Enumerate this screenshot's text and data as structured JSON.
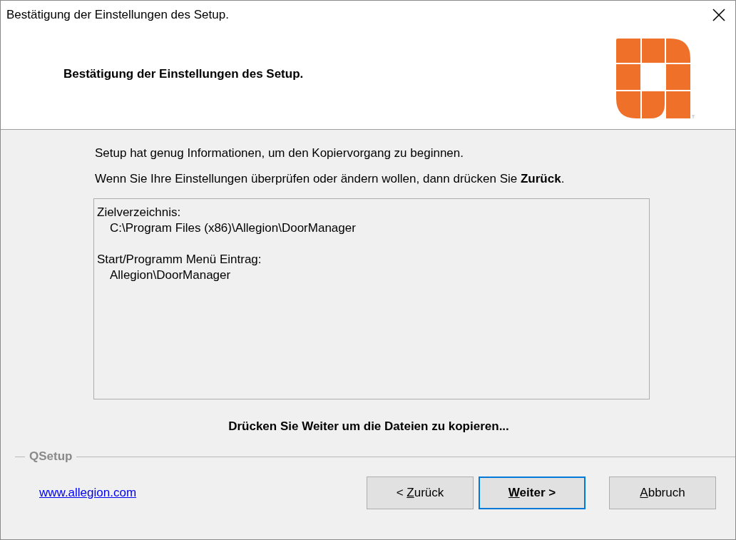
{
  "window": {
    "title": "Bestätigung der Einstellungen des Setup."
  },
  "header": {
    "title": "Bestätigung der Einstellungen des Setup."
  },
  "body": {
    "paragraphs": [
      "Setup hat genug Informationen, um den Kopiervorgang zu beginnen.",
      "Wenn Sie Ihre Einstellungen überprüfen oder ändern wollen, dann drücken Sie **Zurück**."
    ],
    "summary": [
      {
        "kind": "heading",
        "text": "Zielverzeichnis:"
      },
      {
        "kind": "value",
        "text": "C:\\Program Files (x86)\\Allegion\\DoorManager"
      },
      {
        "kind": "spacer"
      },
      {
        "kind": "heading",
        "text": "Start/Programm Menü Eintrag:"
      },
      {
        "kind": "value",
        "text": "Allegion\\DoorManager"
      }
    ],
    "instruction": "Drücken Sie Weiter um die Dateien zu kopieren..."
  },
  "footer": {
    "group_label": "QSetup",
    "link": "www.allegion.com",
    "buttons": [
      {
        "prefix": "< ",
        "mnemonic": "Z",
        "rest": "urück",
        "default": false
      },
      {
        "mnemonic": "W",
        "rest": "eiter >",
        "default": true
      },
      {
        "mnemonic": "A",
        "rest": "bbruch",
        "default": false
      }
    ]
  }
}
